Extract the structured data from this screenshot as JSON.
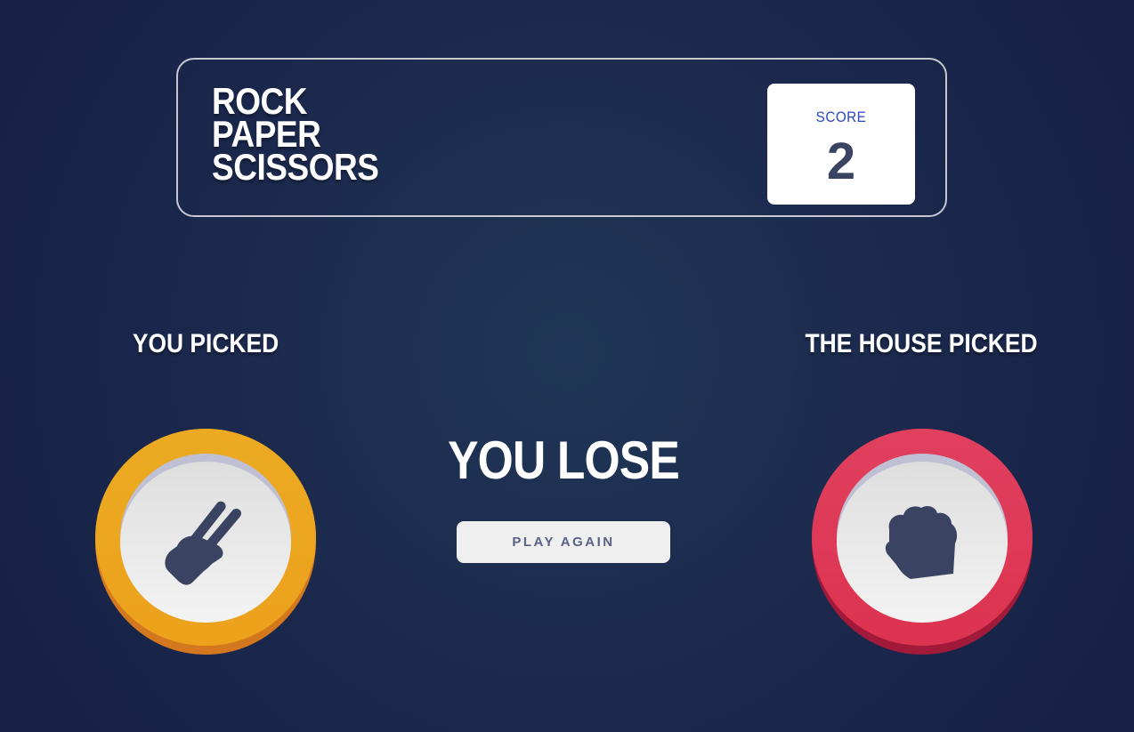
{
  "header": {
    "title_lines": [
      "ROCK",
      "PAPER",
      "SCISSORS"
    ],
    "score_label": "SCORE",
    "score_value": "2"
  },
  "game": {
    "player_label": "YOU PICKED",
    "house_label": "THE HOUSE PICKED",
    "player_choice": "scissors",
    "house_choice": "rock",
    "result": "YOU LOSE",
    "play_again_label": "PLAY AGAIN"
  },
  "icons": {
    "player": "scissors-hand-icon",
    "house": "rock-fist-icon"
  },
  "colors": {
    "background": "#1f3756",
    "scissors_ring": "#eda11c",
    "rock_ring": "#dc3350",
    "score_label": "#2a46c0",
    "score_value": "#3b4363",
    "icon": "#3b4363"
  }
}
